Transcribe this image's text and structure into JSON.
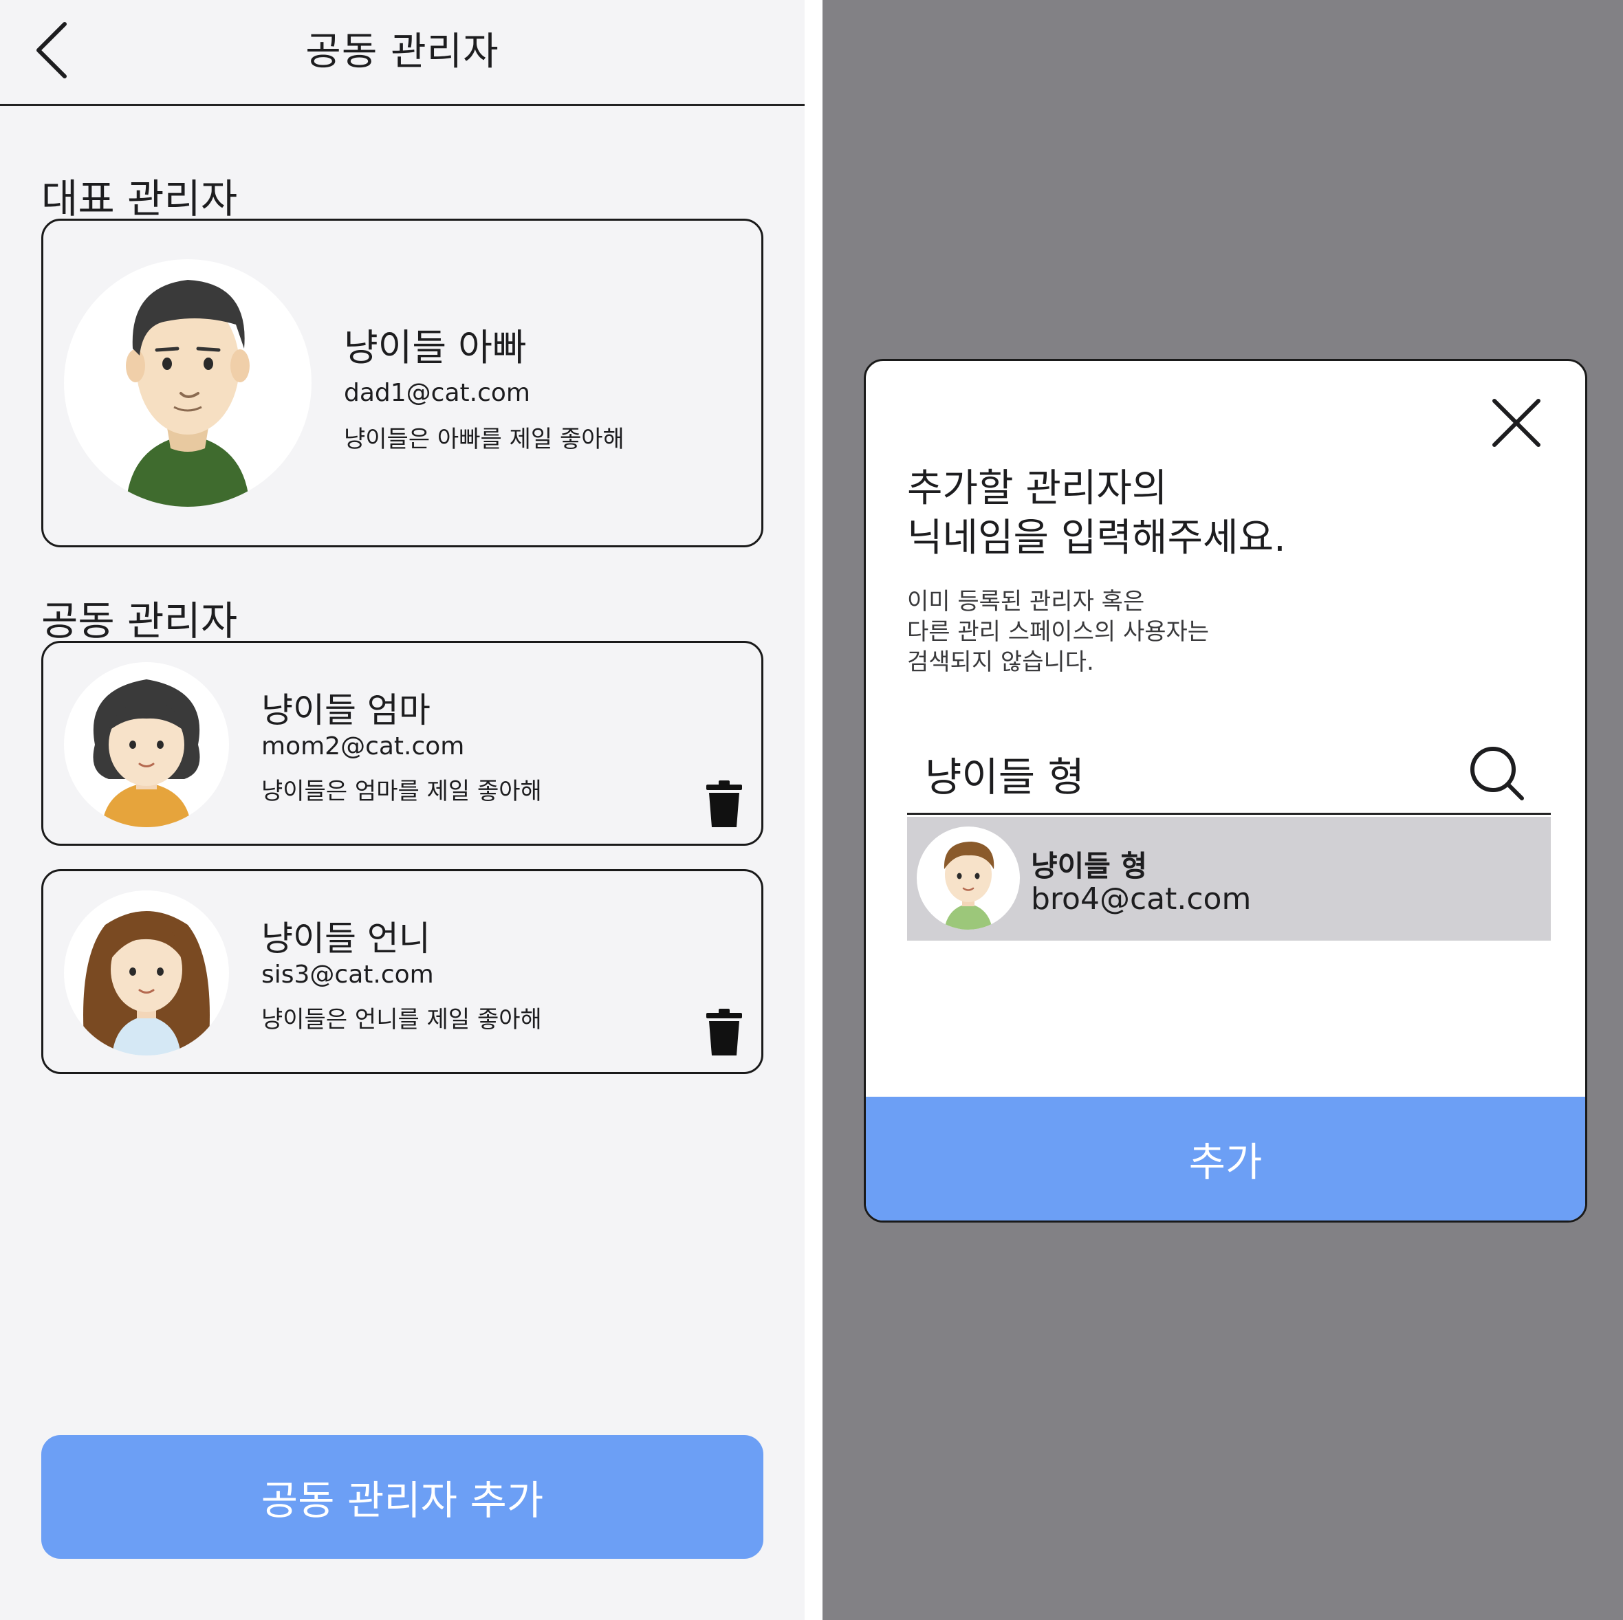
{
  "header": {
    "title": "공동 관리자"
  },
  "main_admin": {
    "section_title": "대표 관리자",
    "name": "냥이들 아빠",
    "email": "dad1@cat.com",
    "desc": "냥이들은 아빠를 제일 좋아해"
  },
  "co_admins": {
    "section_title": "공동 관리자",
    "items": [
      {
        "name": "냥이들 엄마",
        "email": "mom2@cat.com",
        "desc": "냥이들은 엄마를 제일 좋아해"
      },
      {
        "name": "냥이들 언니",
        "email": "sis3@cat.com",
        "desc": "냥이들은 언니를 제일 좋아해"
      }
    ]
  },
  "add_button_label": "공동 관리자 추가",
  "modal": {
    "title_line1": "추가할 관리자의",
    "title_line2": "닉네임을 입력해주세요.",
    "sub_line1": "이미 등록된 관리자 혹은",
    "sub_line2": "다른 관리 스페이스의 사용자는",
    "sub_line3": "검색되지 않습니다.",
    "search_value": "냥이들 형",
    "result": {
      "name": "냥이들 형",
      "email": "bro4@cat.com"
    },
    "add_label": "추가"
  },
  "colors": {
    "accent": "#6c9ff5",
    "overlay": "#828185",
    "background": "#f4f4f6",
    "result_bg": "#d1d0d4"
  },
  "icons": {
    "back": "chevron-left-icon",
    "trash": "trash-icon",
    "close": "close-icon",
    "search": "search-icon"
  }
}
